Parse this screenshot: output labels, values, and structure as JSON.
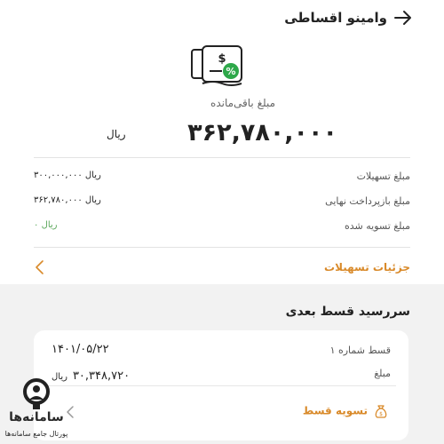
{
  "header": {
    "title": "وامینو اقساطی",
    "back_icon": "arrow-right-icon"
  },
  "hero": {
    "icon": "installment-bill-icon",
    "caption": "مبلغ باقی‌مانده",
    "amount": "۳۶۲,۷۸۰,۰۰۰",
    "currency": "ریال"
  },
  "summary": {
    "rows": [
      {
        "label": "مبلغ تسهیلات",
        "value": "۳۰۰,۰۰۰,۰۰۰ ریال"
      },
      {
        "label": "مبلغ بازپرداخت نهایی",
        "value": "۳۶۲,۷۸۰,۰۰۰ ریال"
      },
      {
        "label": "مبلغ تسویه شده",
        "value": "۰ ریال"
      }
    ]
  },
  "details_link": {
    "label": "جزئیات تسهیلات",
    "icon": "chevron-left-icon"
  },
  "next_installment": {
    "title": "سررسید قسط بعدی",
    "installment_label": "قسط شماره ۱",
    "due_date": "۱۴۰۱/۰۵/۲۲",
    "amount_label": "مبلغ",
    "amount": "۳۰,۳۴۸,۷۲۰",
    "currency": "ریال",
    "pay_label": "تسویه قسط",
    "pay_icon": "money-bag-icon"
  },
  "watermark": {
    "brand": "سامانه‌ها",
    "tagline": "پورتال جامع سامانه‌ها",
    "icon": "magnifier-logo-icon"
  },
  "colors": {
    "accent": "#d98a2a",
    "success": "#5ba75b",
    "illustration": "#2ea84a"
  }
}
